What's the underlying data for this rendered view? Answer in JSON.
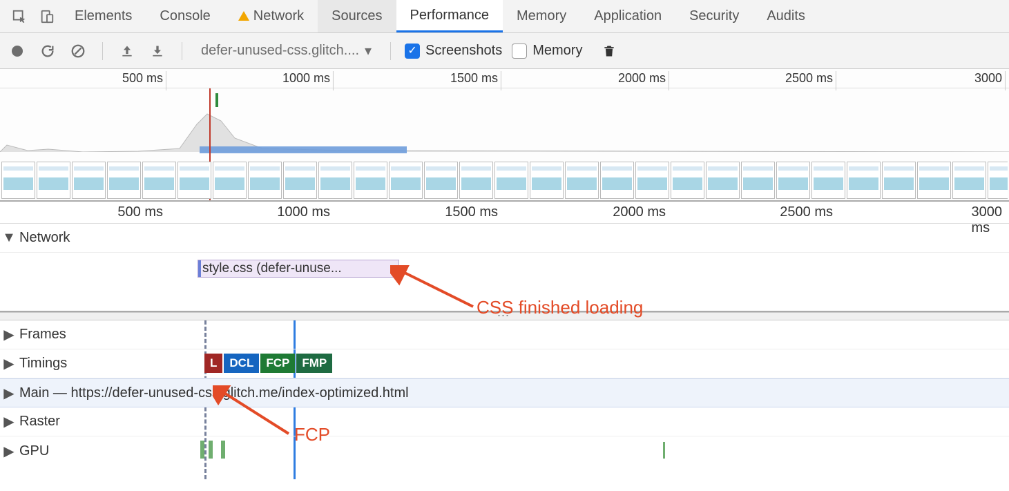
{
  "tabs": {
    "elements": "Elements",
    "console": "Console",
    "network": "Network",
    "sources": "Sources",
    "performance": "Performance",
    "memory": "Memory",
    "application": "Application",
    "security": "Security",
    "audits": "Audits"
  },
  "toolbar": {
    "dropdown": "defer-unused-css.glitch....",
    "screenshots": "Screenshots",
    "memory": "Memory"
  },
  "ruler_overview": [
    "500 ms",
    "1000 ms",
    "1500 ms",
    "2000 ms",
    "2500 ms",
    "3000"
  ],
  "ruler_detail": [
    "500 ms",
    "1000 ms",
    "1500 ms",
    "2000 ms",
    "2500 ms",
    "3000 ms"
  ],
  "sections": {
    "network": "Network",
    "frames": "Frames",
    "timings": "Timings",
    "main": "Main — https://defer-unused-css.glitch.me/index-optimized.html",
    "raster": "Raster",
    "gpu": "GPU"
  },
  "network_bar": "style.css (defer-unuse...",
  "badges": {
    "l": "L",
    "dcl": "DCL",
    "fcp": "FCP",
    "fmp": "FMP"
  },
  "annotations": {
    "css": "CSS finished loading",
    "fcp": "FCP"
  },
  "tick_positions_overview": [
    240,
    482,
    725,
    968,
    1210,
    1455
  ],
  "tick_positions_detail": [
    240,
    482,
    725,
    968,
    1210,
    1455
  ]
}
